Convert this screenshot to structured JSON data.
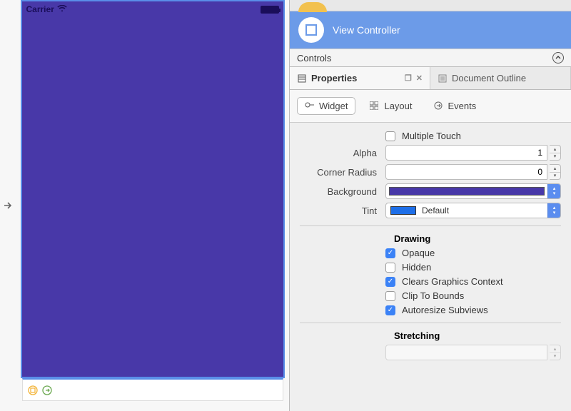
{
  "statusBar": {
    "carrier": "Carrier"
  },
  "hierarchy": {
    "viewController": "View Controller"
  },
  "controlsSection": {
    "label": "Controls"
  },
  "tabs": {
    "properties": "Properties",
    "documentOutline": "Document Outline"
  },
  "subTabs": {
    "widget": "Widget",
    "layout": "Layout",
    "events": "Events"
  },
  "props": {
    "multipleTouch": {
      "label": "Multiple Touch",
      "checked": false
    },
    "alpha": {
      "label": "Alpha",
      "value": "1"
    },
    "cornerRadius": {
      "label": "Corner Radius",
      "value": "0"
    },
    "background": {
      "label": "Background",
      "color": "#4838a8"
    },
    "tint": {
      "label": "Tint",
      "swatch": "#1e6fe8",
      "valueLabel": "Default"
    }
  },
  "drawing": {
    "heading": "Drawing",
    "opaque": {
      "label": "Opaque",
      "checked": true
    },
    "hidden": {
      "label": "Hidden",
      "checked": false
    },
    "clearsGraphics": {
      "label": "Clears Graphics Context",
      "checked": true
    },
    "clipToBounds": {
      "label": "Clip To Bounds",
      "checked": false
    },
    "autoresize": {
      "label": "Autoresize Subviews",
      "checked": true
    }
  },
  "stretching": {
    "heading": "Stretching"
  }
}
